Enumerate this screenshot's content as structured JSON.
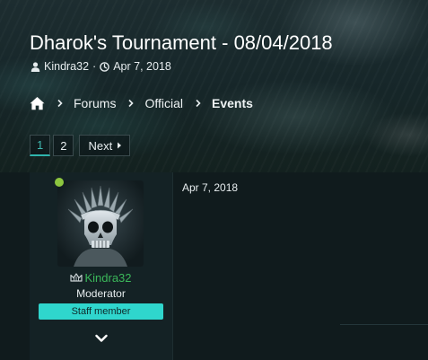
{
  "thread": {
    "title": "Dharok's Tournament - 08/04/2018",
    "author": "Kindra32",
    "separator": "·",
    "date": "Apr 7, 2018"
  },
  "breadcrumb": {
    "home_icon": "home-icon",
    "items": [
      {
        "label": "Forums"
      },
      {
        "label": "Official"
      },
      {
        "label": "Events"
      }
    ]
  },
  "pagination": {
    "pages": [
      "1",
      "2"
    ],
    "current": "1",
    "next_label": "Next"
  },
  "post": {
    "author": {
      "name": "Kindra32",
      "title": "Moderator",
      "badge": "Staff member",
      "online": true,
      "avatar_icon": "skull-headdress-avatar",
      "rank_icon": "crown-icon"
    },
    "date": "Apr 7, 2018"
  },
  "colors": {
    "accent": "#2fd6cd",
    "username": "#3bb85a",
    "online": "#8dc63f",
    "background": "#101b1d"
  }
}
